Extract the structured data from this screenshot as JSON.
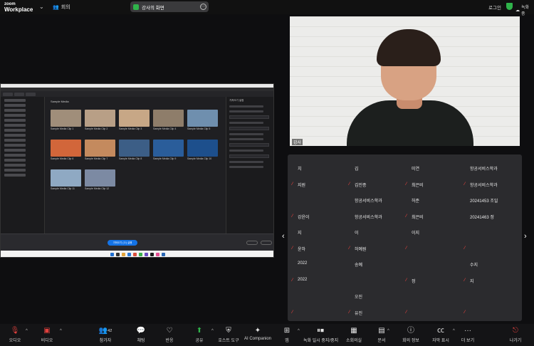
{
  "topbar": {
    "brand_line1": "zoom",
    "brand_line2": "Workplace",
    "meeting_label": "회의",
    "share_pill_label": "강사의 화면",
    "login_label": "로그인",
    "recording_label": "녹화 중"
  },
  "shared_screen": {
    "breadcrumb": "Sample Media",
    "thumbnails": [
      {
        "label": "Sample Media Clip 1",
        "color": "#a08e7a"
      },
      {
        "label": "Sample Media Clip 2",
        "color": "#b89f86"
      },
      {
        "label": "Sample Media Clip 3",
        "color": "#c7a786"
      },
      {
        "label": "Sample Media Clip 4",
        "color": "#8e7d6a"
      },
      {
        "label": "Sample Media Clip 5",
        "color": "#6f8fae"
      },
      {
        "label": "Sample Media Clip 6",
        "color": "#d2663a"
      },
      {
        "label": "Sample Media Clip 7",
        "color": "#c48a5e"
      },
      {
        "label": "Sample Media Clip 8",
        "color": "#3c5e86"
      },
      {
        "label": "Sample Media Clip 9",
        "color": "#2a5d9a"
      },
      {
        "label": "Sample Media Clip 10",
        "color": "#1d4f8c"
      },
      {
        "label": "Sample Media Clip 11",
        "color": "#8fa9c3"
      },
      {
        "label": "Sample Media Clip 12",
        "color": "#7c8aa3"
      }
    ],
    "import_button": "가져오기 (ㅁ) 실행",
    "right_panel_heading": "가져오기 설정"
  },
  "presenter": {
    "name_badge": "강사"
  },
  "gallery": {
    "participants": [
      {
        "name": "치",
        "muted": false
      },
      {
        "name": "김",
        "muted": false
      },
      {
        "name": "미연",
        "muted": false
      },
      {
        "name": "항공서비스학과",
        "muted": false
      },
      {
        "name": "지원",
        "muted": true
      },
      {
        "name": "김민종",
        "muted": true
      },
      {
        "name": "최은비",
        "muted": true
      },
      {
        "name": "항공서비스학과",
        "muted": true
      },
      {
        "name": "",
        "muted": false
      },
      {
        "name": "항공서비스학과",
        "muted": false
      },
      {
        "name": "허준",
        "muted": false
      },
      {
        "name": "20241453 조일",
        "muted": false
      },
      {
        "name": "강윤이",
        "muted": true
      },
      {
        "name": "항공서비스학과",
        "muted": false
      },
      {
        "name": "최은비",
        "muted": true
      },
      {
        "name": "20241463 정",
        "muted": false
      },
      {
        "name": "지",
        "muted": false
      },
      {
        "name": "이",
        "muted": false
      },
      {
        "name": "이지",
        "muted": false
      },
      {
        "name": "",
        "muted": false
      },
      {
        "name": "윤하",
        "muted": true
      },
      {
        "name": "허예원",
        "muted": true
      },
      {
        "name": "",
        "muted": true
      },
      {
        "name": "",
        "muted": true
      },
      {
        "name": "2022",
        "muted": false
      },
      {
        "name": "송예",
        "muted": false
      },
      {
        "name": "",
        "muted": false
      },
      {
        "name": "수지",
        "muted": false
      },
      {
        "name": "2022",
        "muted": true
      },
      {
        "name": "",
        "muted": false
      },
      {
        "name": "정",
        "muted": true
      },
      {
        "name": "지",
        "muted": true
      },
      {
        "name": "",
        "muted": false
      },
      {
        "name": "오진",
        "muted": false
      },
      {
        "name": "",
        "muted": false
      },
      {
        "name": "",
        "muted": false
      },
      {
        "name": "",
        "muted": true
      },
      {
        "name": "유진",
        "muted": true
      },
      {
        "name": "",
        "muted": true
      },
      {
        "name": "",
        "muted": true
      }
    ]
  },
  "bottombar": {
    "audio": "오디오",
    "video": "비디오",
    "participants": "참가자",
    "participants_count": "42",
    "chat": "채팅",
    "reactions": "반응",
    "share": "공유",
    "host_tools": "호스트 도구",
    "ai_companion": "AI Companion",
    "apps": "앱",
    "recording": "녹화 일시 중지/중지",
    "views": "소회의실",
    "docs": "문서",
    "info": "회의 정보",
    "captions": "자막 표시",
    "more": "더 보기",
    "leave": "나가기"
  }
}
